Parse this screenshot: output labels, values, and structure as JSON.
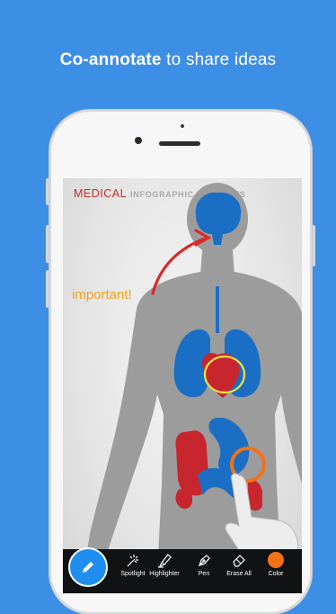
{
  "headline": {
    "bold": "Co-annotate",
    "rest": " to share ideas"
  },
  "screen": {
    "title_main": "MEDICAL",
    "title_sub": "INFOGRAPHIC ELEMENTS",
    "annotation_text": "important!"
  },
  "toolbar": {
    "tools": [
      {
        "label": "Spotlight",
        "icon": "spotlight-icon"
      },
      {
        "label": "Highlighter",
        "icon": "highlighter-icon"
      },
      {
        "label": "Pen",
        "icon": "pen-icon"
      },
      {
        "label": "Erase All",
        "icon": "eraser-icon"
      },
      {
        "label": "Color",
        "icon": "color-swatch"
      }
    ],
    "active_tool_icon": "pencil-icon"
  },
  "colors": {
    "background": "#3d8fe6",
    "organ_blue": "#1a6fc4",
    "organ_red": "#c8262e",
    "annotation_orange": "#f2a21a",
    "circle_yellow": "#e8e04a",
    "arrow_red": "#d92b2b",
    "color_swatch": "#f47216",
    "active_button": "#1f8ef0"
  }
}
